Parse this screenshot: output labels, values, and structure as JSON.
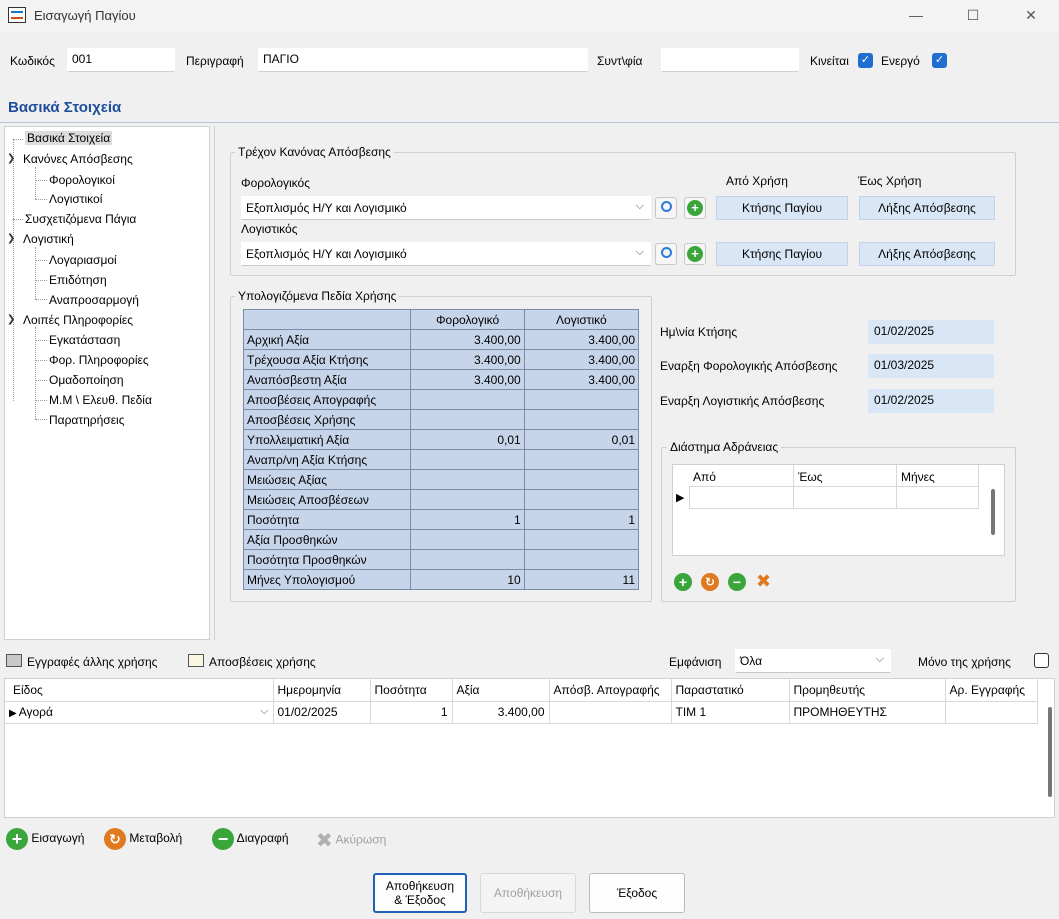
{
  "window": {
    "title": "Εισαγωγή Παγίου",
    "minimize": "—",
    "maximize": "☐",
    "close": "✕"
  },
  "header": {
    "code_label": "Κωδικός",
    "code_value": "001",
    "desc_label": "Περιγραφή",
    "desc_value": "ΠΑΓΙΟ",
    "synt_label": "Συντ\\φία",
    "synt_value": "",
    "moves_label": "Κινείται",
    "moves_checked": true,
    "active_label": "Ενεργό",
    "active_checked": true
  },
  "section_title": "Βασικά Στοιχεία",
  "tree": {
    "items": [
      "Βασικά Στοιχεία",
      "Κανόνες Απόσβεσης",
      "Φορολογικοί",
      "Λογιστικοί",
      "Συσχετιζόμενα Πάγια",
      "Λογιστική",
      "Λογαριασμοί",
      "Επιδότηση",
      "Αναπροσαρμογή",
      "Λοιπές Πληροφορίες",
      "Εγκατάσταση",
      "Φορ. Πληροφορίες",
      "Ομαδοποίηση",
      "Μ.Μ \\ Ελευθ. Πεδία",
      "Παρατηρήσεις"
    ]
  },
  "rule": {
    "group_title": "Τρέχον Κανόνας Απόσβεσης",
    "tax_label": "Φορολογικός",
    "tax_value": "Εξοπλισμός Η/Υ και Λογισμικό",
    "acc_label": "Λογιστικός",
    "acc_value": "Εξοπλισμός Η/Υ και Λογισμικό",
    "from_label": "Από Χρήση",
    "to_label": "Έως Χρήση",
    "from_btn": "Κτήσης Παγίου",
    "to_btn": "Λήξης Απόσβεσης"
  },
  "calc": {
    "group_title": "Υπολογιζόμενα Πεδία Χρήσης",
    "col_tax": "Φορολογικό",
    "col_acc": "Λογιστικό",
    "rows": [
      {
        "label": "Αρχική Αξία",
        "tax": "3.400,00",
        "acc": "3.400,00"
      },
      {
        "label": "Τρέχουσα Αξία Κτήσης",
        "tax": "3.400,00",
        "acc": "3.400,00"
      },
      {
        "label": "Αναπόσβεστη Αξία",
        "tax": "3.400,00",
        "acc": "3.400,00"
      },
      {
        "label": "Αποσβέσεις Απογραφής",
        "tax": "",
        "acc": ""
      },
      {
        "label": "Αποσβέσεις Χρήσης",
        "tax": "",
        "acc": ""
      },
      {
        "label": "Υπολλειματική Αξία",
        "tax": "0,01",
        "acc": "0,01"
      },
      {
        "label": "Αναπρ/νη Αξία Κτήσης",
        "tax": "",
        "acc": ""
      },
      {
        "label": "Μειώσεις Αξίας",
        "tax": "",
        "acc": ""
      },
      {
        "label": "Μειώσεις Αποσβέσεων",
        "tax": "",
        "acc": ""
      },
      {
        "label": "Ποσότητα",
        "tax": "1",
        "acc": "1"
      },
      {
        "label": "Αξία Προσθηκών",
        "tax": "",
        "acc": ""
      },
      {
        "label": "Ποσότητα Προσθηκών",
        "tax": "",
        "acc": ""
      },
      {
        "label": "Μήνες Υπολογισμού",
        "tax": "10",
        "acc": "11"
      }
    ]
  },
  "dates": {
    "acq_label": "Ημ\\νία Κτήσης",
    "acq_value": "01/02/2025",
    "taxstart_label": "Εναρξη Φορολογικής  Απόσβεσης",
    "taxstart_value": "01/03/2025",
    "accstart_label": "Εναρξη Λογιστικής Απόσβεσης",
    "accstart_value": "01/02/2025"
  },
  "idle": {
    "group_title": "Διάστημα Αδράνειας",
    "col_from": "Από",
    "col_to": "Έως",
    "col_months": "Μήνες"
  },
  "bottom": {
    "legend_other": "Εγγραφές άλλης χρήσης",
    "legend_dep": "Αποσβέσεις χρήσης",
    "show_label": "Εμφάνιση",
    "show_value": "Όλα",
    "only_year_label": "Μόνο της χρήσης",
    "columns": [
      "Είδος",
      "Ημερομηνία",
      "Ποσότητα",
      "Αξία",
      "Απόσβ. Απογραφής",
      "Παραστατικό",
      "Προμηθευτής",
      "Αρ. Εγγραφής"
    ],
    "rows": [
      {
        "type": "Αγορά",
        "date": "01/02/2025",
        "qty": "1",
        "value": "3.400,00",
        "dep": "",
        "doc": "ΤΙΜ 1",
        "supplier": "ΠΡΟΜΗΘΕΥΤΗΣ",
        "reg": ""
      }
    ]
  },
  "actions": {
    "insert": "Εισαγωγή",
    "modify": "Μεταβολή",
    "delete": "Διαγραφή",
    "cancel": "Ακύρωση"
  },
  "footer": {
    "save_exit_line1": "Αποθήκευση",
    "save_exit_line2": "& Έξοδος",
    "save": "Αποθήκευση",
    "exit": "Έξοδος"
  },
  "colors": {
    "accent": "#1f4e9c",
    "field_blue": "#d8e6f5",
    "grid_blue": "#c7d5ea",
    "check_blue": "#1f6fd1",
    "green": "#3aa53a",
    "orange": "#e07a1f"
  }
}
